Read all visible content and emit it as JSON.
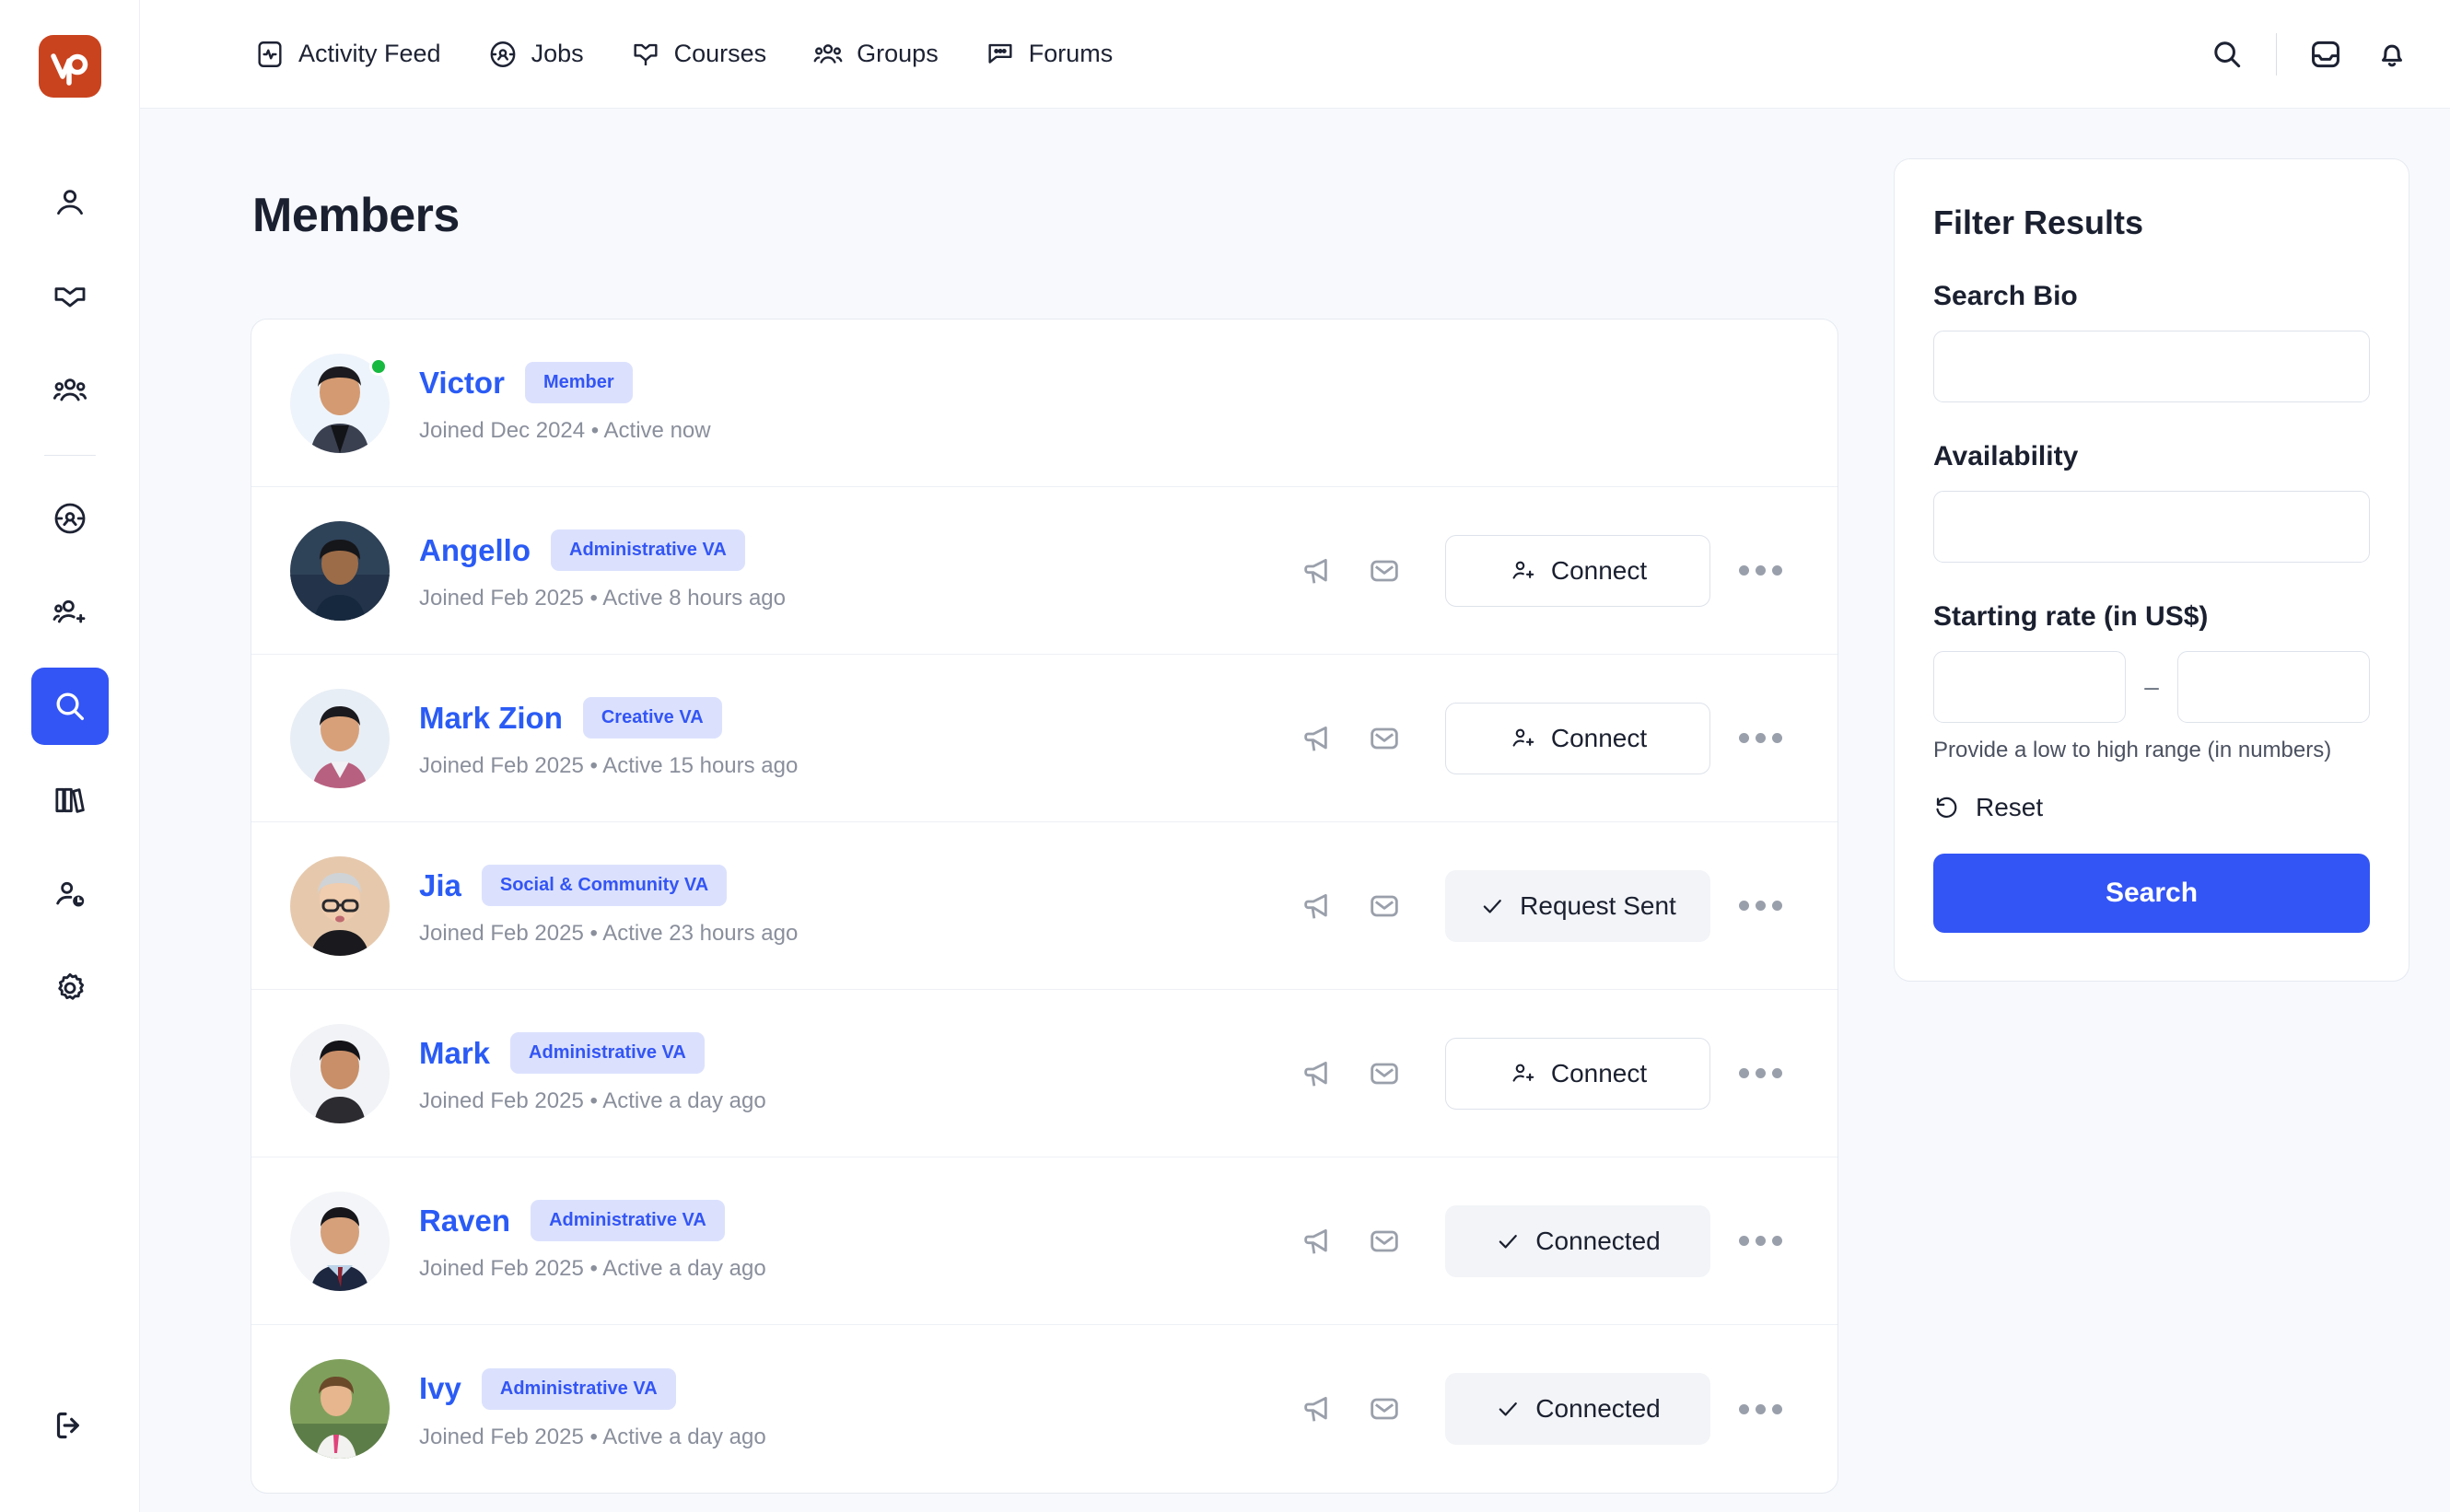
{
  "brand": {
    "logo_text": "vp",
    "logo_color": "#c9431f"
  },
  "accent": {
    "primary": "#3355f5",
    "link": "#2a5bf5",
    "badge_bg": "#dbe1fd",
    "online": "#17b93f"
  },
  "sidebar": {
    "items": [
      {
        "name": "profile",
        "icon": "user-icon"
      },
      {
        "name": "bookmarks",
        "icon": "open-book-icon"
      },
      {
        "name": "groups",
        "icon": "people-icon"
      },
      {
        "name": "jobs",
        "icon": "target-icon"
      },
      {
        "name": "connections",
        "icon": "add-person-icon"
      },
      {
        "name": "search",
        "icon": "search-icon",
        "active": true
      },
      {
        "name": "library",
        "icon": "books-icon"
      },
      {
        "name": "time-tracking",
        "icon": "person-clock-icon"
      },
      {
        "name": "settings",
        "icon": "gear-icon"
      }
    ],
    "logout": {
      "name": "logout",
      "icon": "logout-icon"
    }
  },
  "topnav": {
    "items": [
      {
        "label": "Activity Feed",
        "icon": "activity-icon"
      },
      {
        "label": "Jobs",
        "icon": "target-icon"
      },
      {
        "label": "Courses",
        "icon": "courses-icon"
      },
      {
        "label": "Groups",
        "icon": "people-icon"
      },
      {
        "label": "Forums",
        "icon": "chat-icon"
      }
    ],
    "actions": [
      {
        "name": "search",
        "icon": "search-icon"
      },
      {
        "name": "inbox",
        "icon": "inbox-icon"
      },
      {
        "name": "notifications",
        "icon": "bell-icon"
      }
    ]
  },
  "main": {
    "title": "Members",
    "members": [
      {
        "name": "Victor",
        "badge": "Member",
        "meta": "Joined Dec 2024  •  Active now",
        "online": true,
        "has_actions": false,
        "cta": null,
        "cta_state": null,
        "avatar": "victor"
      },
      {
        "name": "Angello",
        "badge": "Administrative VA",
        "meta": "Joined Feb 2025  •  Active 8 hours ago",
        "online": false,
        "has_actions": true,
        "cta": "Connect",
        "cta_state": "connect",
        "avatar": "angello"
      },
      {
        "name": "Mark Zion",
        "badge": "Creative VA",
        "meta": "Joined Feb 2025  •  Active 15 hours ago",
        "online": false,
        "has_actions": true,
        "cta": "Connect",
        "cta_state": "connect",
        "avatar": "markzion"
      },
      {
        "name": "Jia",
        "badge": "Social & Community VA",
        "meta": "Joined Feb 2025  •  Active 23 hours ago",
        "online": false,
        "has_actions": true,
        "cta": "Request Sent",
        "cta_state": "done",
        "avatar": "jia"
      },
      {
        "name": "Mark",
        "badge": "Administrative VA",
        "meta": "Joined Feb 2025  •  Active a day ago",
        "online": false,
        "has_actions": true,
        "cta": "Connect",
        "cta_state": "connect",
        "avatar": "mark"
      },
      {
        "name": "Raven",
        "badge": "Administrative VA",
        "meta": "Joined Feb 2025  •  Active a day ago",
        "online": false,
        "has_actions": true,
        "cta": "Connected",
        "cta_state": "done",
        "avatar": "raven"
      },
      {
        "name": "Ivy",
        "badge": "Administrative VA",
        "meta": "Joined Feb 2025  •  Active a day ago",
        "online": false,
        "has_actions": true,
        "cta": "Connected",
        "cta_state": "done",
        "avatar": "ivy"
      }
    ],
    "row_icons": [
      {
        "name": "megaphone",
        "icon": "megaphone-icon"
      },
      {
        "name": "message",
        "icon": "envelope-icon"
      }
    ]
  },
  "filter": {
    "title": "Filter Results",
    "search_bio_label": "Search Bio",
    "search_bio_value": "",
    "search_bio_placeholder": "",
    "availability_label": "Availability",
    "availability_value": "",
    "availability_placeholder": "",
    "rate_label": "Starting rate (in US$)",
    "rate_min_value": "",
    "rate_max_value": "",
    "rate_separator": "–",
    "rate_hint": "Provide a low to high range (in numbers)",
    "reset_label": "Reset",
    "search_label": "Search"
  }
}
